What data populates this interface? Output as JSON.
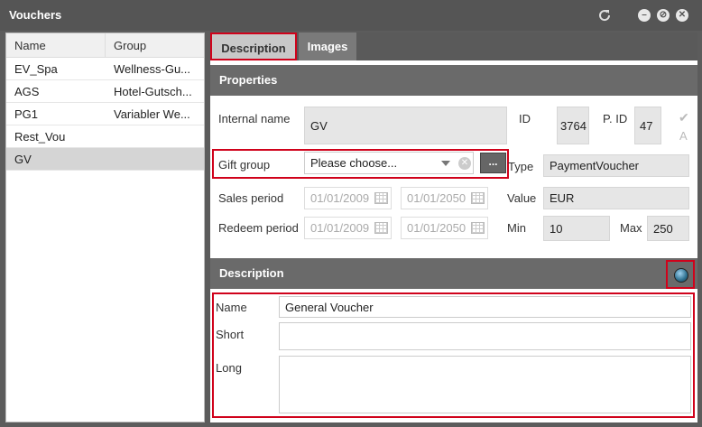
{
  "window": {
    "title": "Vouchers"
  },
  "list": {
    "columns": [
      "Name",
      "Group"
    ],
    "rows": [
      {
        "name": "EV_Spa",
        "group": "Wellness-Gu..."
      },
      {
        "name": "AGS",
        "group": "Hotel-Gutsch..."
      },
      {
        "name": "PG1",
        "group": "Variabler We..."
      },
      {
        "name": "Rest_Vou",
        "group": ""
      },
      {
        "name": "GV",
        "group": ""
      }
    ]
  },
  "tabs": {
    "description": "Description",
    "images": "Images"
  },
  "properties": {
    "header": "Properties",
    "internal_name_label": "Internal name",
    "internal_name": "GV",
    "id_label": "ID",
    "id": "3764",
    "pid_label": "P. ID",
    "pid": "47",
    "active_label": "A",
    "gift_group_label": "Gift group",
    "gift_group_placeholder": "Please choose...",
    "dots_label": "...",
    "type_label": "Type",
    "type": "PaymentVoucher",
    "sales_period_label": "Sales period",
    "sales_from": "01/01/2009",
    "sales_to": "01/01/2050",
    "value_label": "Value",
    "value": "EUR",
    "redeem_period_label": "Redeem period",
    "redeem_from": "01/01/2009",
    "redeem_to": "01/01/2050",
    "min_label": "Min",
    "min": "10",
    "max_label": "Max",
    "max": "250"
  },
  "description": {
    "header": "Description",
    "name_label": "Name",
    "name": "General Voucher",
    "short_label": "Short",
    "short": "",
    "long_label": "Long",
    "long": ""
  }
}
